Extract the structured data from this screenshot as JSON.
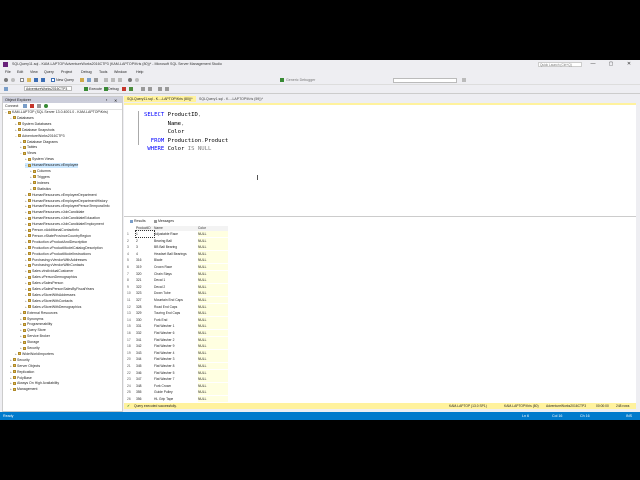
{
  "window": {
    "title": "SQLQuery11.sql - KAM-LAPTOP.AdventureWorks2016CTP3 (KAM-LAPTOP\\Kris (80))* - Microsoft SQL Server Management Studio",
    "search_placeholder": "Quick Launch (Ctrl+Q)",
    "minimize": "—",
    "maximize": "▢",
    "close": "✕"
  },
  "menu": [
    "File",
    "Edit",
    "View",
    "Query",
    "Project",
    "Debug",
    "Tools",
    "Window",
    "Help"
  ],
  "toolbar": {
    "new_query": "New Query",
    "database": "AdventureWorks2016CTP3",
    "execute": "Execute",
    "debug": "Debug",
    "generic_debugger": "Generic Debugger"
  },
  "object_explorer": {
    "header": "Object Explorer",
    "connect": "Connect",
    "tree": [
      {
        "label": "KAM-LAPTOP (SQL Server 13.0.4001.0 - KAM-LAPTOP\\Kris)",
        "indent": 0,
        "exp": "−"
      },
      {
        "label": "Databases",
        "indent": 1,
        "exp": "−"
      },
      {
        "label": "System Databases",
        "indent": 2,
        "exp": "+"
      },
      {
        "label": "Database Snapshots",
        "indent": 2,
        "exp": "+"
      },
      {
        "label": "AdventureWorks2016CTP3",
        "indent": 2,
        "exp": "−"
      },
      {
        "label": "Database Diagrams",
        "indent": 3,
        "exp": "+"
      },
      {
        "label": "Tables",
        "indent": 3,
        "exp": "+"
      },
      {
        "label": "Views",
        "indent": 3,
        "exp": "−"
      },
      {
        "label": "System Views",
        "indent": 4,
        "exp": "+"
      },
      {
        "label": "HumanResources.vEmployee",
        "indent": 4,
        "exp": "−",
        "selected": true
      },
      {
        "label": "Columns",
        "indent": 5,
        "exp": "+"
      },
      {
        "label": "Triggers",
        "indent": 5,
        "exp": "+"
      },
      {
        "label": "Indexes",
        "indent": 5,
        "exp": "+"
      },
      {
        "label": "Statistics",
        "indent": 5,
        "exp": "+"
      },
      {
        "label": "HumanResources.vEmployeeDepartment",
        "indent": 4,
        "exp": "+"
      },
      {
        "label": "HumanResources.vEmployeeDepartmentHistory",
        "indent": 4,
        "exp": "+"
      },
      {
        "label": "HumanResources.vEmployeePersonTemporalInfo",
        "indent": 4,
        "exp": "+"
      },
      {
        "label": "HumanResources.vJobCandidate",
        "indent": 4,
        "exp": "+"
      },
      {
        "label": "HumanResources.vJobCandidateEducation",
        "indent": 4,
        "exp": "+"
      },
      {
        "label": "HumanResources.vJobCandidateEmployment",
        "indent": 4,
        "exp": "+"
      },
      {
        "label": "Person.vAdditionalContactInfo",
        "indent": 4,
        "exp": "+"
      },
      {
        "label": "Person.vStateProvinceCountryRegion",
        "indent": 4,
        "exp": "+"
      },
      {
        "label": "Production.vProductAndDescription",
        "indent": 4,
        "exp": "+"
      },
      {
        "label": "Production.vProductModelCatalogDescription",
        "indent": 4,
        "exp": "+"
      },
      {
        "label": "Production.vProductModelInstructions",
        "indent": 4,
        "exp": "+"
      },
      {
        "label": "Purchasing.vVendorWithAddresses",
        "indent": 4,
        "exp": "+"
      },
      {
        "label": "Purchasing.vVendorWithContacts",
        "indent": 4,
        "exp": "+"
      },
      {
        "label": "Sales.vIndividualCustomer",
        "indent": 4,
        "exp": "+"
      },
      {
        "label": "Sales.vPersonDemographics",
        "indent": 4,
        "exp": "+"
      },
      {
        "label": "Sales.vSalesPerson",
        "indent": 4,
        "exp": "+"
      },
      {
        "label": "Sales.vSalesPersonSalesByFiscalYears",
        "indent": 4,
        "exp": "+"
      },
      {
        "label": "Sales.vStoreWithAddresses",
        "indent": 4,
        "exp": "+"
      },
      {
        "label": "Sales.vStoreWithContacts",
        "indent": 4,
        "exp": "+"
      },
      {
        "label": "Sales.vStoreWithDemographics",
        "indent": 4,
        "exp": "+"
      },
      {
        "label": "External Resources",
        "indent": 3,
        "exp": "+"
      },
      {
        "label": "Synonyms",
        "indent": 3,
        "exp": "+"
      },
      {
        "label": "Programmability",
        "indent": 3,
        "exp": "+"
      },
      {
        "label": "Query Store",
        "indent": 3,
        "exp": "+"
      },
      {
        "label": "Service Broker",
        "indent": 3,
        "exp": "+"
      },
      {
        "label": "Storage",
        "indent": 3,
        "exp": "+"
      },
      {
        "label": "Security",
        "indent": 3,
        "exp": "+"
      },
      {
        "label": "WideWorldImporters",
        "indent": 2,
        "exp": "+"
      },
      {
        "label": "Security",
        "indent": 1,
        "exp": "+"
      },
      {
        "label": "Server Objects",
        "indent": 1,
        "exp": "+"
      },
      {
        "label": "Replication",
        "indent": 1,
        "exp": "+"
      },
      {
        "label": "PolyBase",
        "indent": 1,
        "exp": "+"
      },
      {
        "label": "Always On High Availability",
        "indent": 1,
        "exp": "+"
      },
      {
        "label": "Management",
        "indent": 1,
        "exp": "+"
      }
    ]
  },
  "tabs": [
    {
      "label": "SQLQuery11.sql - K...-LAPTOP\\Kris (80))*",
      "active": true
    },
    {
      "label": "SQLQuery1.sql - K...-LAPTOP\\Kris (59))*",
      "active": false
    }
  ],
  "editor": {
    "lines": [
      [
        {
          "t": "SELECT ",
          "c": "kw"
        },
        {
          "t": "ProductID",
          "c": "id"
        },
        {
          "t": ",",
          "c": "gray"
        }
      ],
      [
        {
          "t": "       Name",
          "c": "id"
        },
        {
          "t": ",",
          "c": "gray"
        }
      ],
      [
        {
          "t": "       Color",
          "c": "id"
        }
      ],
      [
        {
          "t": "  FROM ",
          "c": "kw"
        },
        {
          "t": "Production",
          "c": "id"
        },
        {
          "t": ".",
          "c": "gray"
        },
        {
          "t": "Product",
          "c": "id"
        }
      ],
      [
        {
          "t": " WHERE ",
          "c": "kw"
        },
        {
          "t": "Color ",
          "c": "id"
        },
        {
          "t": "IS NULL",
          "c": "gray"
        }
      ]
    ]
  },
  "results": {
    "tab_results": "Results",
    "tab_messages": "Messages",
    "columns": [
      "ProductID",
      "Name",
      "Color"
    ],
    "rows": [
      [
        "1",
        "Adjustable Race",
        "NULL"
      ],
      [
        "2",
        "Bearing Ball",
        "NULL"
      ],
      [
        "3",
        "BB Ball Bearing",
        "NULL"
      ],
      [
        "4",
        "Headset Ball Bearings",
        "NULL"
      ],
      [
        "316",
        "Blade",
        "NULL"
      ],
      [
        "319",
        "Crown Race",
        "NULL"
      ],
      [
        "320",
        "Chain Stays",
        "NULL"
      ],
      [
        "321",
        "Decal 1",
        "NULL"
      ],
      [
        "322",
        "Decal 2",
        "NULL"
      ],
      [
        "323",
        "Down Tube",
        "NULL"
      ],
      [
        "327",
        "Mountain End Caps",
        "NULL"
      ],
      [
        "328",
        "Road End Caps",
        "NULL"
      ],
      [
        "329",
        "Touring End Caps",
        "NULL"
      ],
      [
        "330",
        "Fork End",
        "NULL"
      ],
      [
        "331",
        "Flat Washer 1",
        "NULL"
      ],
      [
        "332",
        "Flat Washer 6",
        "NULL"
      ],
      [
        "341",
        "Flat Washer 2",
        "NULL"
      ],
      [
        "342",
        "Flat Washer 9",
        "NULL"
      ],
      [
        "343",
        "Flat Washer 4",
        "NULL"
      ],
      [
        "344",
        "Flat Washer 3",
        "NULL"
      ],
      [
        "345",
        "Flat Washer 8",
        "NULL"
      ],
      [
        "346",
        "Flat Washer 5",
        "NULL"
      ],
      [
        "347",
        "Flat Washer 7",
        "NULL"
      ],
      [
        "348",
        "Fork Crown",
        "NULL"
      ],
      [
        "355",
        "Guide Pulley",
        "NULL"
      ],
      [
        "356",
        "HL Grip Tape",
        "NULL"
      ]
    ],
    "status": "Query executed successfully.",
    "server": "KAM-LAPTOP (13.0 SP1)",
    "user": "KAM-LAPTOP\\Kris (80)",
    "database": "AdventureWorks2016CTP3",
    "time": "00:00:00",
    "row_count": "248 rows"
  },
  "statusbar": {
    "ready": "Ready",
    "ln": "Ln 6",
    "col": "Col 16",
    "ch": "Ch 16",
    "ins": "INS"
  },
  "colors": {
    "accent": "#007ACC",
    "tab_active": "#FFF29D",
    "keyword": "#0000FF"
  }
}
